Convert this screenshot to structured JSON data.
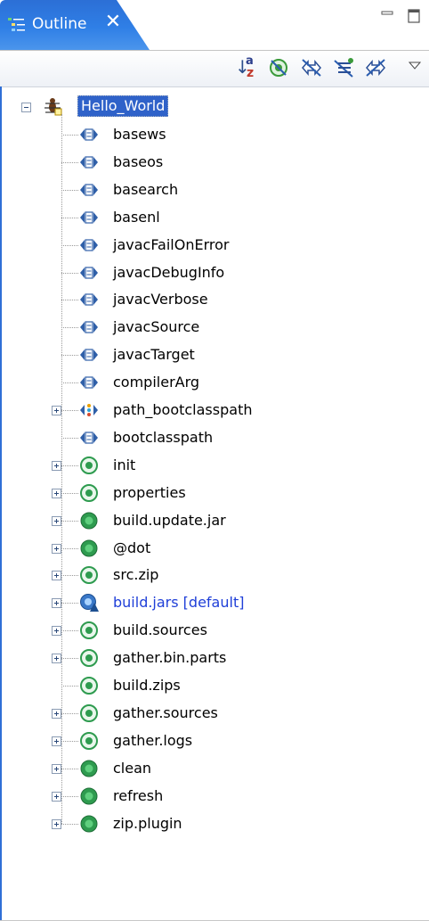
{
  "view": {
    "tab_title": "Outline",
    "close_symbol": "✕"
  },
  "toolbar": {
    "sort_a": "a",
    "sort_z": "z",
    "buttons": [
      "sort-icon",
      "hide-fields-icon",
      "hide-static-icon",
      "hide-nonpublic-icon",
      "hide-local-types-icon"
    ]
  },
  "tree": {
    "root": {
      "label": "Hello_World",
      "icon": "ant-project-icon",
      "expanded": true,
      "selected": true
    },
    "properties": [
      {
        "label": "basews",
        "expandable": false
      },
      {
        "label": "baseos",
        "expandable": false
      },
      {
        "label": "basearch",
        "expandable": false
      },
      {
        "label": "basenl",
        "expandable": false
      },
      {
        "label": "javacFailOnError",
        "expandable": false
      },
      {
        "label": "javacDebugInfo",
        "expandable": false
      },
      {
        "label": "javacVerbose",
        "expandable": false
      },
      {
        "label": "javacSource",
        "expandable": false
      },
      {
        "label": "javacTarget",
        "expandable": false
      },
      {
        "label": "compilerArg",
        "expandable": false
      },
      {
        "label": "path_bootclasspath",
        "expandable": true,
        "kind": "path"
      },
      {
        "label": "bootclasspath",
        "expandable": false
      }
    ],
    "targets": [
      {
        "label": "init",
        "expandable": true,
        "kind": "target"
      },
      {
        "label": "properties",
        "expandable": true,
        "kind": "target"
      },
      {
        "label": "build.update.jar",
        "expandable": true,
        "kind": "public-target"
      },
      {
        "label": "@dot",
        "expandable": true,
        "kind": "public-target"
      },
      {
        "label": "src.zip",
        "expandable": true,
        "kind": "target"
      },
      {
        "label": "build.jars [default]",
        "expandable": true,
        "kind": "default-target"
      },
      {
        "label": "build.sources",
        "expandable": true,
        "kind": "target"
      },
      {
        "label": "gather.bin.parts",
        "expandable": true,
        "kind": "target"
      },
      {
        "label": "build.zips",
        "expandable": false,
        "kind": "target"
      },
      {
        "label": "gather.sources",
        "expandable": true,
        "kind": "target"
      },
      {
        "label": "gather.logs",
        "expandable": true,
        "kind": "target"
      },
      {
        "label": "clean",
        "expandable": true,
        "kind": "public-target"
      },
      {
        "label": "refresh",
        "expandable": true,
        "kind": "public-target"
      },
      {
        "label": "zip.plugin",
        "expandable": true,
        "kind": "public-target"
      }
    ]
  },
  "colors": {
    "tab_blue": "#2f7fe6",
    "selection": "#2f62c9",
    "default_target_text": "#1f3fd8",
    "target_green": "#2e9b4f"
  }
}
